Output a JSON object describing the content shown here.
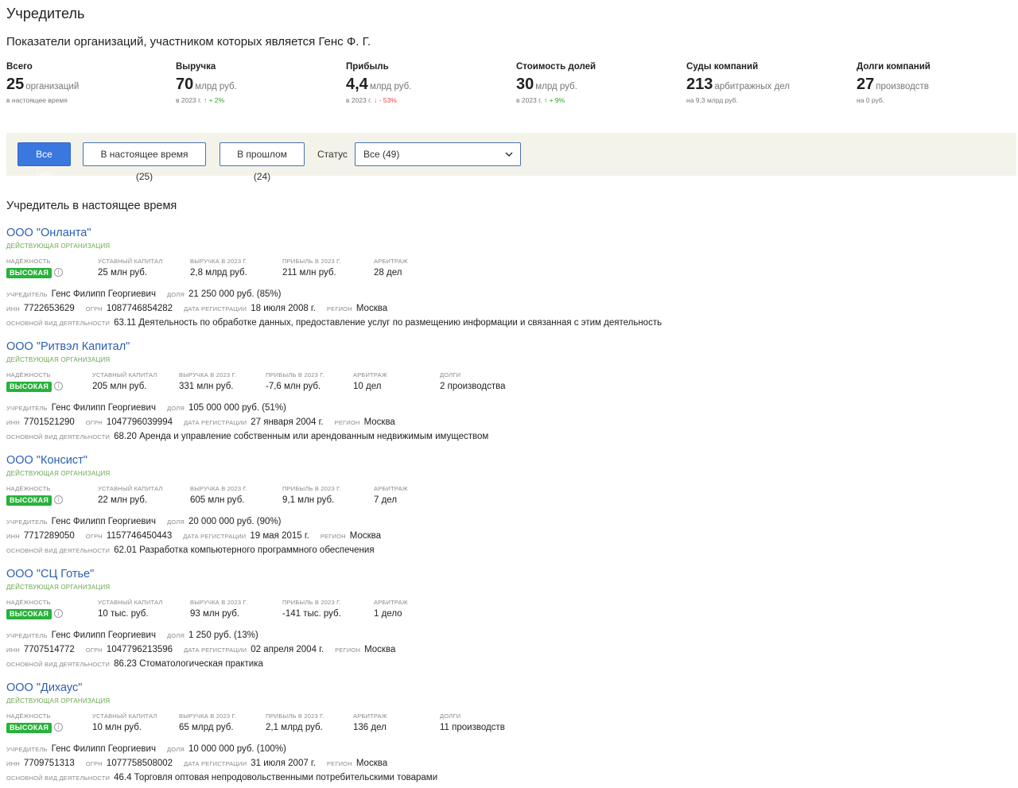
{
  "header": {
    "title": "Учредитель",
    "subtitle": "Показатели организаций, участником которых является Генс Ф. Г."
  },
  "stats": [
    {
      "label": "Всего",
      "value": "25",
      "unit": "организаций",
      "note": "в настоящее время",
      "trend": "",
      "trend_dir": ""
    },
    {
      "label": "Выручка",
      "value": "70",
      "unit": "млрд руб.",
      "note": "в 2023 г.",
      "trend": "+ 2%",
      "trend_dir": "up"
    },
    {
      "label": "Прибыль",
      "value": "4,4",
      "unit": "млрд руб.",
      "note": "в 2023 г.",
      "trend": "- 53%",
      "trend_dir": "down"
    },
    {
      "label": "Стоимость долей",
      "value": "30",
      "unit": "млрд руб.",
      "note": "в 2023 г.",
      "trend": "+ 9%",
      "trend_dir": "up"
    },
    {
      "label": "Суды компаний",
      "value": "213",
      "unit": "арбитражных дел",
      "note": "на 9,3 млрд руб.",
      "trend": "",
      "trend_dir": ""
    },
    {
      "label": "Долги компаний",
      "value": "27",
      "unit": "производств",
      "note": "на 0 руб.",
      "trend": "",
      "trend_dir": ""
    }
  ],
  "filters": {
    "all": "Все (49)",
    "current": "В настоящее время (25)",
    "past": "В прошлом (24)",
    "status_label": "Статус",
    "status_value": "Все (49)"
  },
  "section_title": "Учредитель в настоящее время",
  "labels": {
    "reliability": "Надёжность",
    "capital": "Уставный капитал",
    "revenue": "Выручка в 2023 г.",
    "profit": "Прибыль в 2023 г.",
    "arbitration": "Арбитраж",
    "debts": "Долги",
    "founder": "Учредитель",
    "share": "Доля",
    "inn": "ИНН",
    "ogrn": "ОГРН",
    "reg_date": "Дата регистрации",
    "region": "Регион",
    "activity": "Основной вид деятельности"
  },
  "companies": [
    {
      "name": "ООО \"Онланта\"",
      "status": "Действующая организация",
      "reliability": "ВЫСОКАЯ",
      "capital": "25 млн руб.",
      "revenue": "2,8 млрд руб.",
      "profit": "211 млн руб.",
      "arbitration": "28 дел",
      "debts": "",
      "founder": "Генс Филипп Георгиевич",
      "share": "21 250 000 руб. (85%)",
      "inn": "7722653629",
      "ogrn": "1087746854282",
      "reg_date": "18 июля 2008 г.",
      "region": "Москва",
      "activity": "63.11 Деятельность по обработке данных, предоставление услуг по размещению информации и связанная с этим деятельность"
    },
    {
      "name": "ООО \"Ритвэл Капитал\"",
      "status": "Действующая организация",
      "reliability": "ВЫСОКАЯ",
      "capital": "205 млн руб.",
      "revenue": "331 млн руб.",
      "profit": "-7,6 млн руб.",
      "arbitration": "10 дел",
      "debts": "2 производства",
      "founder": "Генс Филипп Георгиевич",
      "share": "105 000 000 руб. (51%)",
      "inn": "7701521290",
      "ogrn": "1047796039994",
      "reg_date": "27 января 2004 г.",
      "region": "Москва",
      "activity": "68.20 Аренда и управление собственным или арендованным недвижимым имуществом"
    },
    {
      "name": "ООО \"Консист\"",
      "status": "Действующая организация",
      "reliability": "ВЫСОКАЯ",
      "capital": "22 млн руб.",
      "revenue": "605 млн руб.",
      "profit": "9,1 млн руб.",
      "arbitration": "7 дел",
      "debts": "",
      "founder": "Генс Филипп Георгиевич",
      "share": "20 000 000 руб. (90%)",
      "inn": "7717289050",
      "ogrn": "1157746450443",
      "reg_date": "19 мая 2015 г.",
      "region": "Москва",
      "activity": "62.01 Разработка компьютерного программного обеспечения"
    },
    {
      "name": "ООО \"СЦ Готье\"",
      "status": "Действующая организация",
      "reliability": "ВЫСОКАЯ",
      "capital": "10 тыс. руб.",
      "revenue": "93 млн руб.",
      "profit": "-141 тыс. руб.",
      "arbitration": "1 дело",
      "debts": "",
      "founder": "Генс Филипп Георгиевич",
      "share": "1 250 руб. (13%)",
      "inn": "7707514772",
      "ogrn": "1047796213596",
      "reg_date": "02 апреля 2004 г.",
      "region": "Москва",
      "activity": "86.23 Стоматологическая практика"
    },
    {
      "name": "ООО \"Дихаус\"",
      "status": "Действующая организация",
      "reliability": "ВЫСОКАЯ",
      "capital": "10 млн руб.",
      "revenue": "65 млрд руб.",
      "profit": "2,1 млрд руб.",
      "arbitration": "136 дел",
      "debts": "11 производств",
      "founder": "Генс Филипп Георгиевич",
      "share": "10 000 000 руб. (100%)",
      "inn": "7709751313",
      "ogrn": "1077758508002",
      "reg_date": "31 июля 2007 г.",
      "region": "Москва",
      "activity": "46.4 Торговля оптовая непродовольственными потребительскими товарами"
    }
  ],
  "colors": {
    "link": "#2b5fb0",
    "active_status": "#6aa84f",
    "badge": "#27b23a",
    "up": "#2fa52f",
    "down": "#e04646",
    "accent_button": "#3a78e0"
  }
}
